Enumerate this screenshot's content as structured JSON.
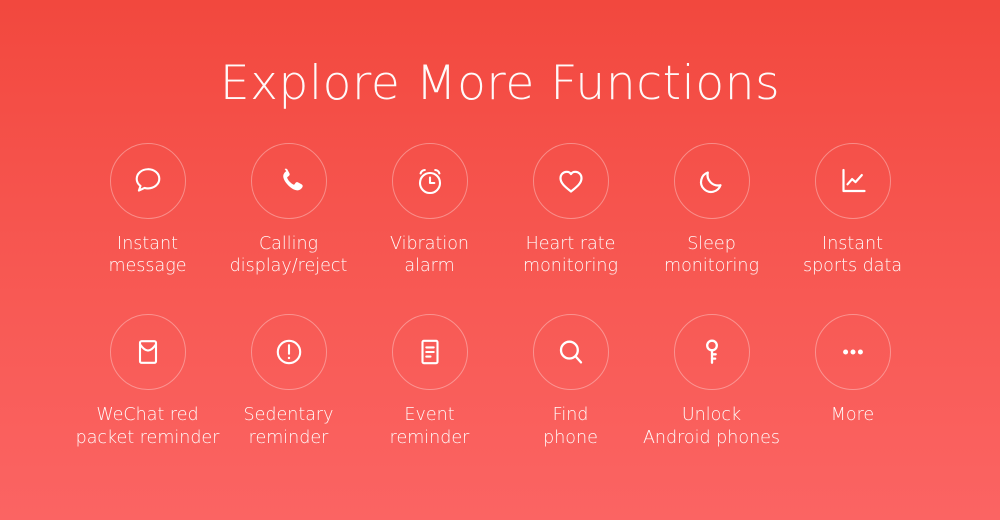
{
  "header": {
    "title": "Explore More Functions"
  },
  "theme": {
    "background_top": "#f2483e",
    "background_bottom": "#fb6463",
    "text_color": "#ffffff",
    "circle_border": "rgba(255,255,255,0.34)"
  },
  "features": {
    "rows": [
      {
        "items": [
          {
            "icon": "chat-bubble-icon",
            "label": "Instant\nmessage"
          },
          {
            "icon": "phone-handset-icon",
            "label": "Calling\ndisplay/reject"
          },
          {
            "icon": "alarm-clock-icon",
            "label": "Vibration\nalarm"
          },
          {
            "icon": "heart-icon",
            "label": "Heart rate\nmonitoring"
          },
          {
            "icon": "crescent-moon-icon",
            "label": "Sleep\nmonitoring"
          },
          {
            "icon": "line-chart-icon",
            "label": "Instant\nsports data"
          }
        ]
      },
      {
        "items": [
          {
            "icon": "envelope-icon",
            "label": "WeChat red\npacket reminder"
          },
          {
            "icon": "exclamation-circle-icon",
            "label": "Sedentary\nreminder"
          },
          {
            "icon": "document-lines-icon",
            "label": "Event\nreminder"
          },
          {
            "icon": "magnifier-icon",
            "label": "Find\nphone"
          },
          {
            "icon": "key-icon",
            "label": "Unlock\nAndroid phones"
          },
          {
            "icon": "ellipsis-icon",
            "label": "More"
          }
        ]
      }
    ]
  }
}
